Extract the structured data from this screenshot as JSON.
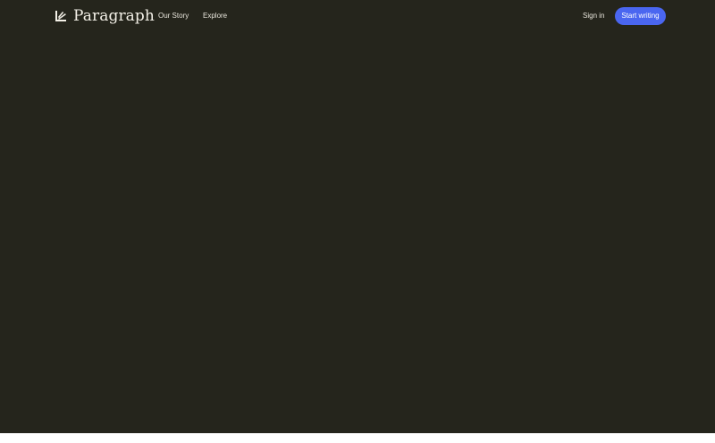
{
  "header": {
    "brand": "Paragraph",
    "logo_icon": "paragraph-logo-icon",
    "nav": [
      {
        "label": "Our Story"
      },
      {
        "label": "Explore"
      }
    ],
    "signin_label": "Sign in",
    "cta_label": "Start writing"
  },
  "colors": {
    "background": "#25251c",
    "text": "#f4f1e8",
    "accent": "#4a66f0"
  }
}
